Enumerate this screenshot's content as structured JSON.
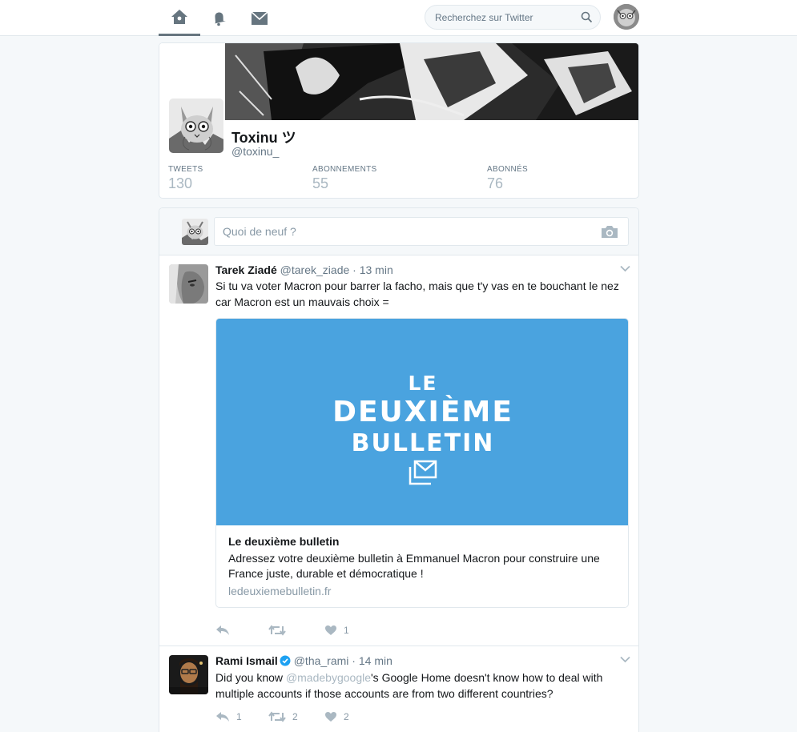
{
  "nav": {
    "home_icon": "home-icon",
    "notifications_icon": "bell-icon",
    "messages_icon": "envelope-icon",
    "search_placeholder": "Recherchez sur Twitter"
  },
  "profile": {
    "name": "Toxinu ツ",
    "handle": "@toxinu_",
    "stats": [
      {
        "label": "Tweets",
        "value": "130"
      },
      {
        "label": "Abonnements",
        "value": "55"
      },
      {
        "label": "Abonnés",
        "value": "76"
      }
    ]
  },
  "composer": {
    "placeholder": "Quoi de neuf ?"
  },
  "tweets": [
    {
      "name": "Tarek Ziadé",
      "handle": "@tarek_ziade",
      "time": "13 min",
      "text": "Si tu va voter Macron pour barrer la facho, mais que t'y vas en te bouchant le nez car Macron est un mauvais choix =",
      "card": {
        "logo_line1": "LE",
        "logo_line2": "DEUXIÈME",
        "logo_line3": "BULLETIN",
        "title": "Le deuxième bulletin",
        "description": "Adressez votre deuxième bulletin à Emmanuel Macron pour construire une France juste, durable et démocratique !",
        "domain": "ledeuxiemebulletin.fr"
      },
      "replies": "",
      "retweets": "",
      "likes": "1"
    },
    {
      "name": "Rami Ismail",
      "handle": "@tha_rami",
      "time": "14 min",
      "text_mention": "@madebygoogle",
      "text_before": "Did you know ",
      "text_after": "'s Google Home doesn't know how to deal with multiple accounts if those accounts are from two different countries?",
      "replies": "1",
      "retweets": "2",
      "likes": "2"
    }
  ],
  "colors": {
    "accent": "#1da1f2",
    "card_blue": "#4aa3df",
    "muted": "#657786"
  }
}
